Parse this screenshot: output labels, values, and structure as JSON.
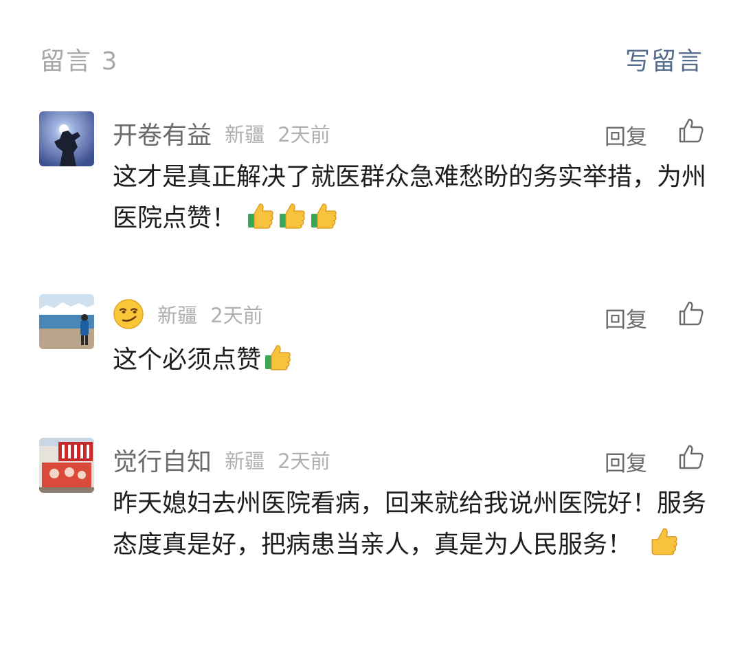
{
  "header": {
    "title": "留言 3",
    "write_label": "写留言"
  },
  "comments": [
    {
      "nickname": "开卷有益",
      "location": "新疆",
      "time": "2天前",
      "reply_label": "回复",
      "text": "这才是真正解决了就医群众急难愁盼的务实举措，为州医院点赞！",
      "emojis": [
        "thumbs-up",
        "thumbs-up",
        "thumbs-up"
      ]
    },
    {
      "nickname_emoji": "smirk-face",
      "location": "新疆",
      "time": "2天前",
      "reply_label": "回复",
      "text": "这个必须点赞",
      "emojis": [
        "thumbs-up"
      ]
    },
    {
      "nickname": "觉行自知",
      "location": "新疆",
      "time": "2天前",
      "reply_label": "回复",
      "text": "昨天媳妇去州医院看病，回来就给我说州医院好！服务态度真是好，把病患当亲人，真是为人民服务！",
      "emojis": [
        "thumbs-up"
      ]
    }
  ],
  "colors": {
    "link_blue": "#566c8d",
    "muted": "#a7a7a7",
    "text": "#1e1e1e"
  }
}
